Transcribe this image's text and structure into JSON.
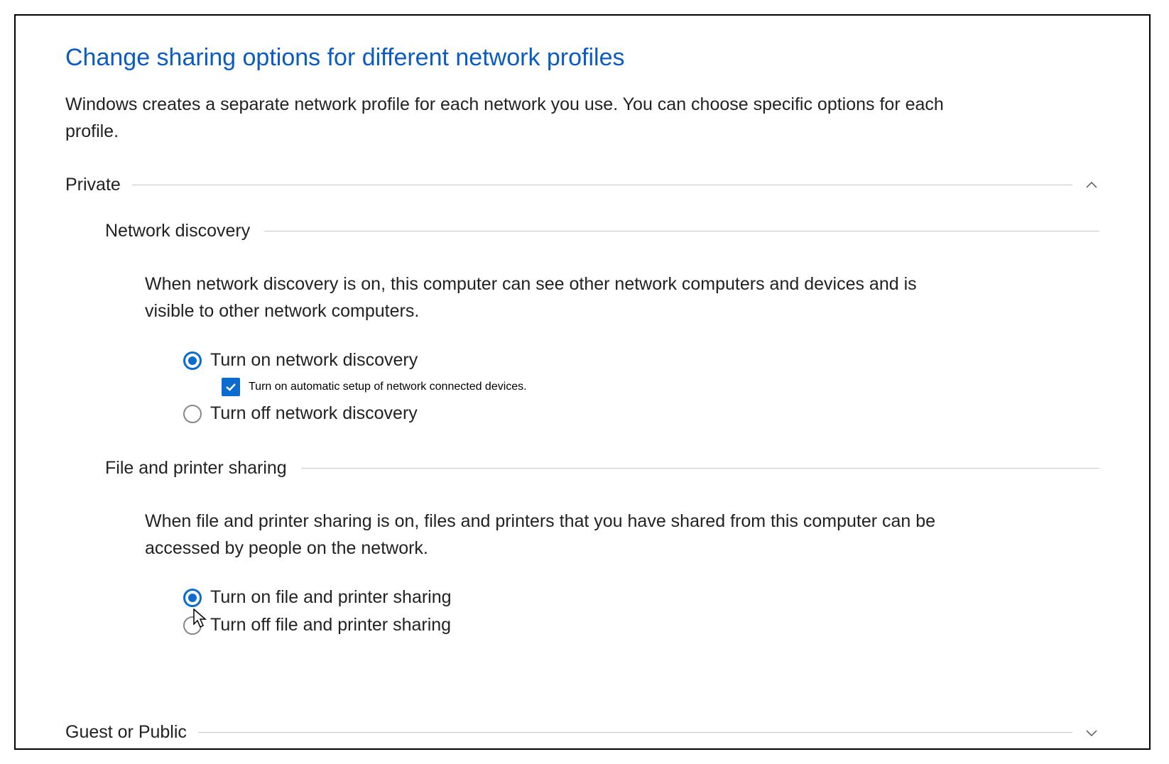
{
  "title": "Change sharing options for different network profiles",
  "subtitle": "Windows creates a separate network profile for each network you use. You can choose specific options for each profile.",
  "sections": {
    "private": {
      "label": "Private",
      "expanded": true,
      "network_discovery": {
        "label": "Network discovery",
        "desc": "When network discovery is on, this computer can see other network computers and devices and is visible to other network computers.",
        "options": {
          "on": "Turn on network discovery",
          "auto_setup": "Turn on automatic setup of network connected devices.",
          "off": "Turn off network discovery"
        },
        "selected": "on",
        "auto_setup_checked": true
      },
      "file_printer": {
        "label": "File and printer sharing",
        "desc": "When file and printer sharing is on, files and printers that you have shared from this computer can be accessed by people on the network.",
        "options": {
          "on": "Turn on file and printer sharing",
          "off": "Turn off file and printer sharing"
        },
        "selected": "on"
      }
    },
    "guest_public": {
      "label": "Guest or Public",
      "expanded": false
    }
  },
  "colors": {
    "accent": "#0a6cce",
    "title": "#0a5bc4"
  }
}
